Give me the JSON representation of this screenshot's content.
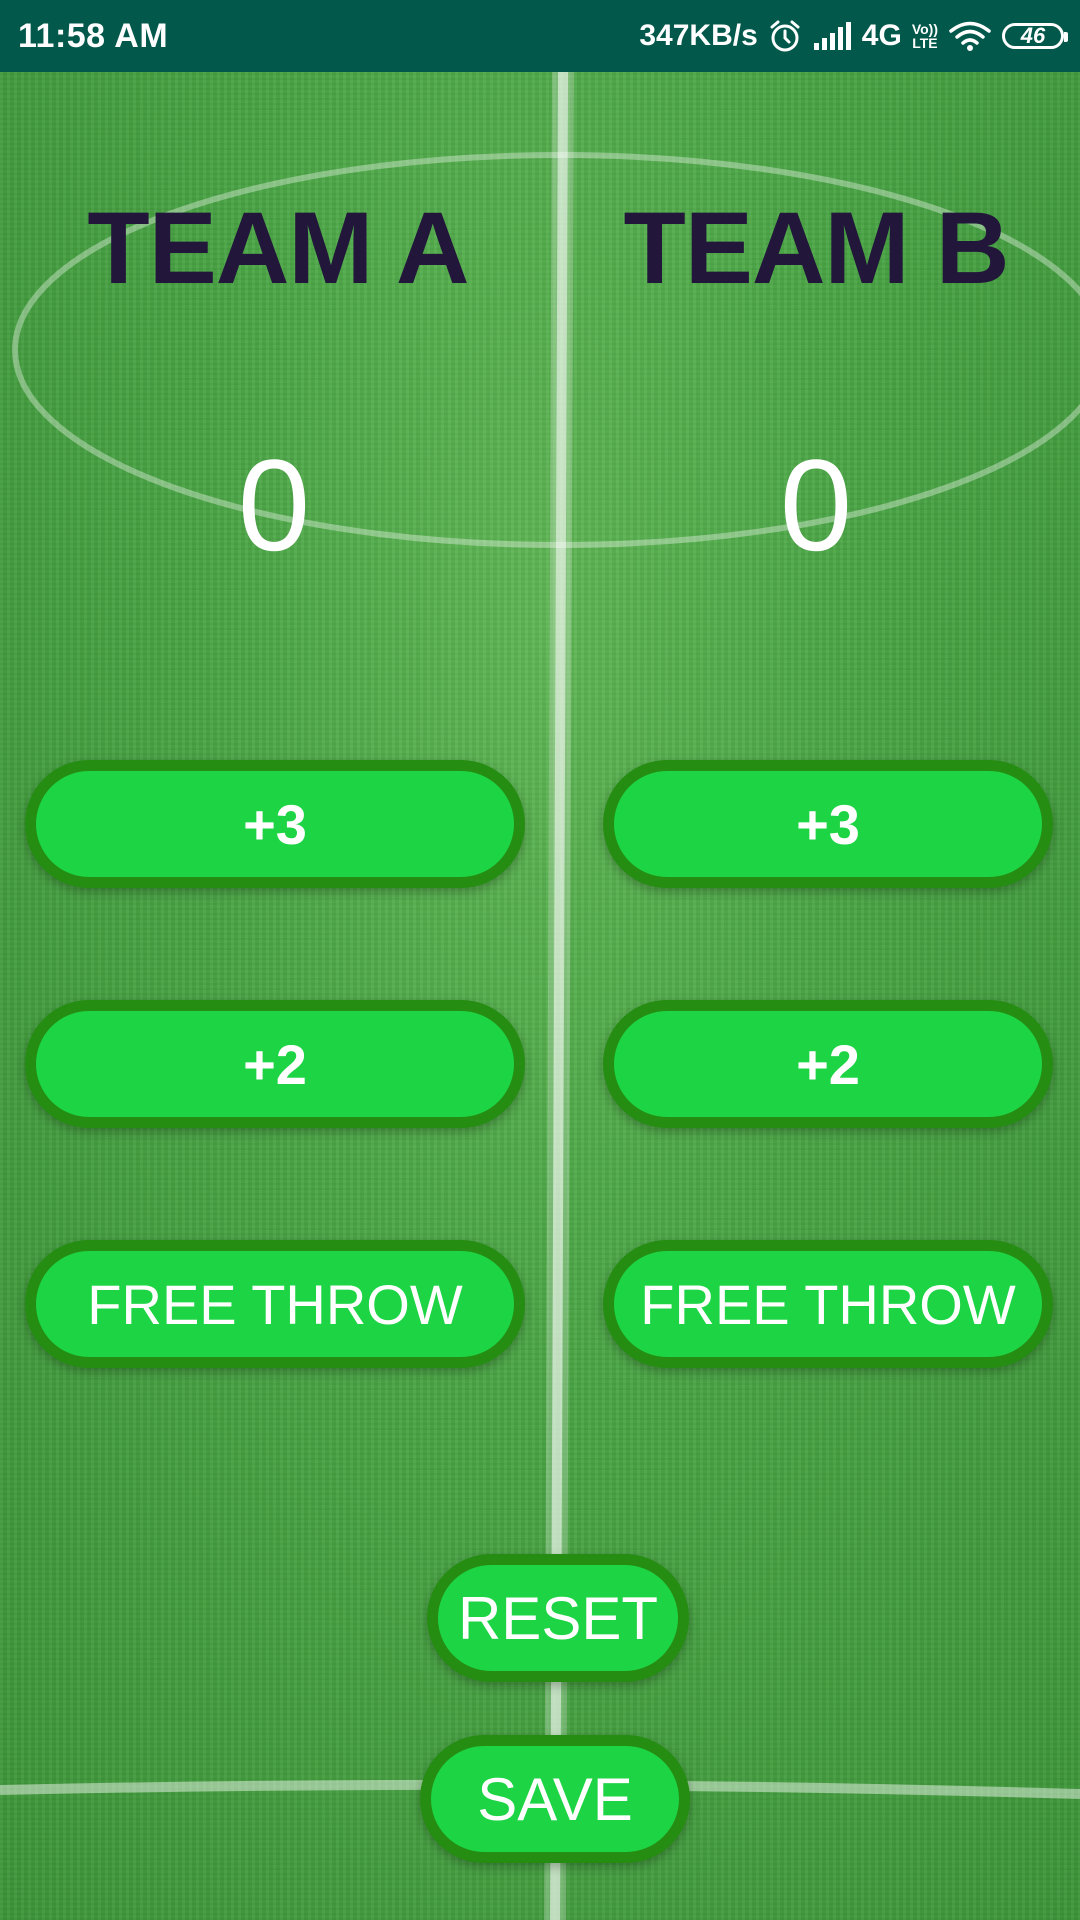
{
  "status_bar": {
    "time": "11:58 AM",
    "speed": "347KB/s",
    "network": "4G",
    "volte_top": "Vo))",
    "volte_bottom": "LTE",
    "battery": "46",
    "icons": [
      "alarm-icon",
      "signal-icon",
      "wifi-icon",
      "battery-icon"
    ]
  },
  "team_a": {
    "name": "TEAM A",
    "score": "0",
    "buttons": {
      "plus3": "+3",
      "plus2": "+2",
      "free_throw": "FREE THROW"
    }
  },
  "team_b": {
    "name": "TEAM B",
    "score": "0",
    "buttons": {
      "plus3": "+3",
      "plus2": "+2",
      "free_throw": "FREE THROW"
    }
  },
  "actions": {
    "reset": "RESET",
    "save": "SAVE"
  },
  "colors": {
    "status_bar": "#02584a",
    "button_fill": "#1dd445",
    "button_border": "#258d12",
    "team_name": "#22163a",
    "score": "#ffffff"
  }
}
